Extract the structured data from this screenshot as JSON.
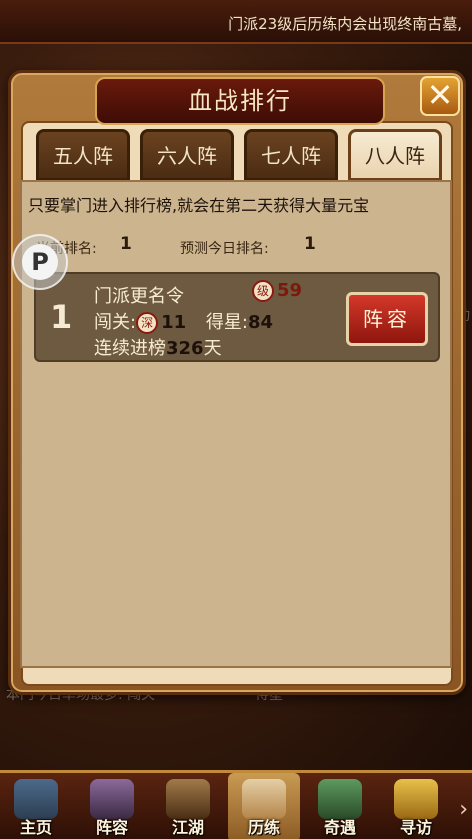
{
  "marquee": {
    "text": "门派23级后历练内会出现终南古墓,"
  },
  "background": {
    "behind_text": "本门今日单场最多:  闯关",
    "behind_edge": "动",
    "behind_right": "得星"
  },
  "dialog": {
    "title": "血战排行",
    "close_label": "✕",
    "tabs": [
      {
        "label": "五人阵",
        "active": false
      },
      {
        "label": "六人阵",
        "active": false
      },
      {
        "label": "七人阵",
        "active": false
      },
      {
        "label": "八人阵",
        "active": true
      }
    ],
    "notice": "只要掌门进入排行榜,就会在第二天获得大量元宝",
    "current_rank_label": "当前排名:",
    "current_rank_value": "1",
    "predicted_rank_label": "预测今日排名:",
    "predicted_rank_value": "1",
    "entry": {
      "rank": "1",
      "name": "门派更名令",
      "level_icon": "级",
      "level": "59",
      "stage_label": "闯关:",
      "stage_icon": "深",
      "stage_value": "11",
      "stars_label": "得星:",
      "stars_value": "84",
      "streak_label": "连续进榜",
      "streak_value": "326",
      "streak_unit": "天",
      "lineup_button": "阵容"
    }
  },
  "widget": {
    "label": "P"
  },
  "bottom_nav": [
    {
      "label": "主页",
      "icon": "home-icon",
      "active": false
    },
    {
      "label": "阵容",
      "icon": "lineup-icon",
      "active": false
    },
    {
      "label": "江湖",
      "icon": "jianghu-icon",
      "active": false
    },
    {
      "label": "历练",
      "icon": "training-icon",
      "active": true
    },
    {
      "label": "奇遇",
      "icon": "encounter-icon",
      "active": false
    },
    {
      "label": "寻访",
      "icon": "visit-icon",
      "active": false
    }
  ],
  "nav_more": "›",
  "colors": {
    "accent_red": "#c22a1c",
    "panel_bg": "#cbb48e",
    "frame": "#8a5523"
  }
}
